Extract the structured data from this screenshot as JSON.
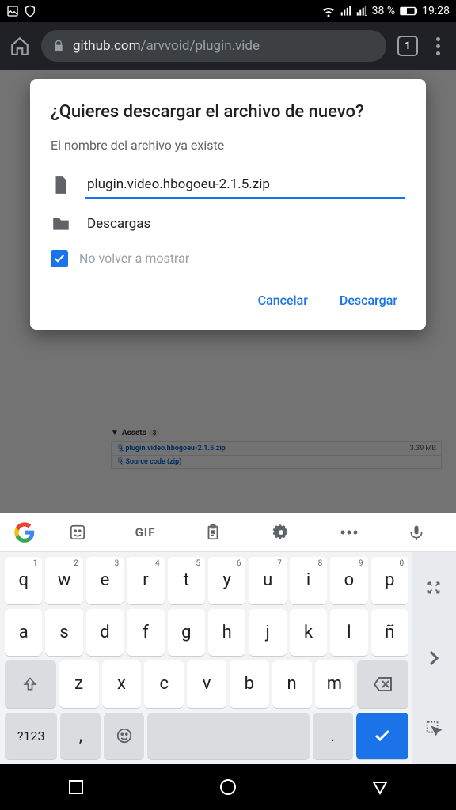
{
  "status": {
    "battery": "38 %",
    "time": "19:28"
  },
  "browser": {
    "host": "github.com",
    "path": "/arvvoid/plugin.vide",
    "tabs": "1"
  },
  "assets": {
    "header": "Assets",
    "count": "3",
    "rows": [
      {
        "name": "plugin.video.hbogoeu-2.1.5.zip",
        "size": "3.39 MB"
      },
      {
        "name": "Source code (zip)",
        "size": ""
      }
    ]
  },
  "dialog": {
    "title": "¿Quieres descargar el archivo de nuevo?",
    "subtitle": "El nombre del archivo ya existe",
    "filename": "plugin.video.hbogoeu-2.1.5.zip",
    "folder": "Descargas",
    "dontshow": "No volver a mostrar",
    "cancel": "Cancelar",
    "download": "Descargar"
  },
  "keyboard": {
    "toolbar_gif": "GIF",
    "row1": [
      {
        "k": "q",
        "n": "1"
      },
      {
        "k": "w",
        "n": "2"
      },
      {
        "k": "e",
        "n": "3"
      },
      {
        "k": "r",
        "n": "4"
      },
      {
        "k": "t",
        "n": "5"
      },
      {
        "k": "y",
        "n": "6"
      },
      {
        "k": "u",
        "n": "7"
      },
      {
        "k": "i",
        "n": "8"
      },
      {
        "k": "o",
        "n": "9"
      },
      {
        "k": "p",
        "n": "0"
      }
    ],
    "row2": [
      "a",
      "s",
      "d",
      "f",
      "g",
      "h",
      "j",
      "k",
      "l",
      "ñ"
    ],
    "row3": [
      "z",
      "x",
      "c",
      "v",
      "b",
      "n",
      "m"
    ],
    "sym": "?123",
    "comma": ",",
    "period": "."
  }
}
